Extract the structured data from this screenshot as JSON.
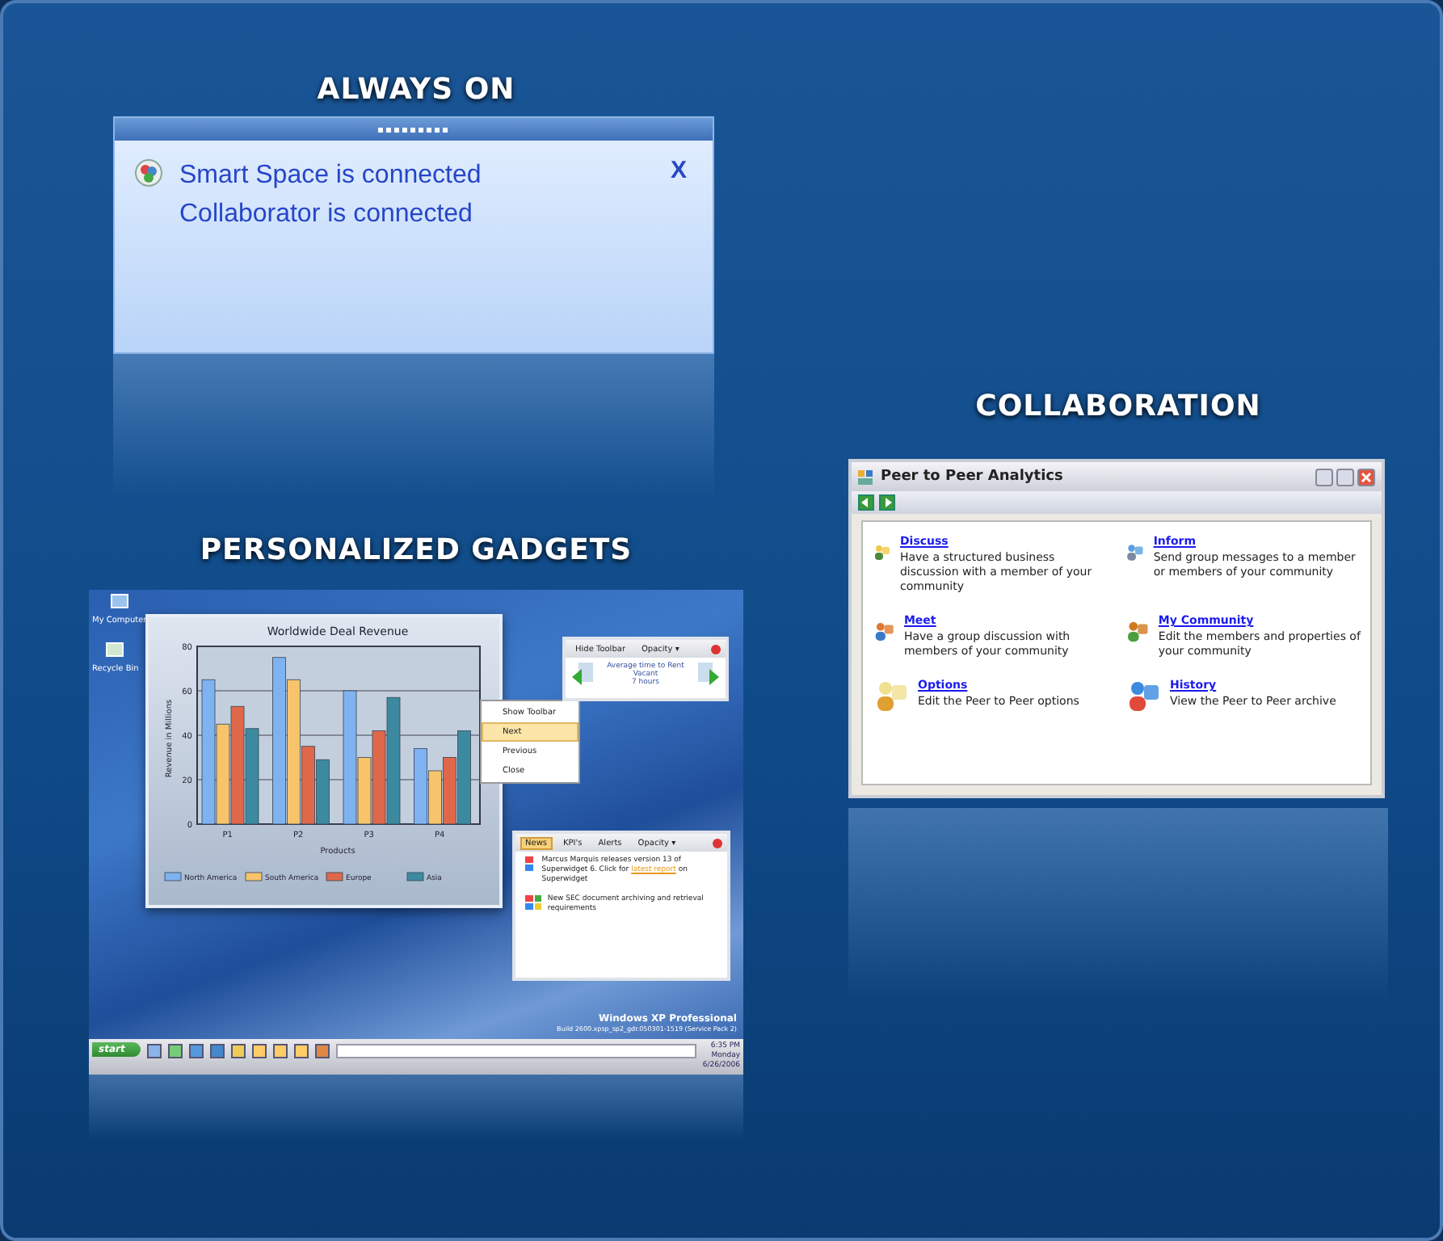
{
  "sections": [
    {
      "heading": "ALWAYS ON"
    },
    {
      "heading": "PERSONALIZED GADGETS"
    },
    {
      "heading": "COLLABORATION"
    }
  ],
  "notification": {
    "lines": [
      "Smart Space is connected",
      "Collaborator is connected"
    ],
    "close": "X"
  },
  "desktop": {
    "icons": [
      {
        "label": "My Computer"
      },
      {
        "label": "Recycle Bin"
      }
    ],
    "chart_window": {
      "chart_data": {
        "type": "bar",
        "title": "Worldwide Deal Revenue",
        "xlabel": "Products",
        "ylabel": "Revenue in Millions",
        "categories": [
          "P1",
          "P2",
          "P3",
          "P4"
        ],
        "yticks": [
          0,
          20,
          40,
          60,
          80
        ],
        "ylim": [
          0,
          80
        ],
        "grid": true,
        "legend": "bottom",
        "series": [
          {
            "name": "North America",
            "color": "#7fb2f0",
            "values": [
              65,
              75,
              60,
              34
            ]
          },
          {
            "name": "South America",
            "color": "#f7c46c",
            "values": [
              45,
              65,
              30,
              24
            ]
          },
          {
            "name": "Europe",
            "color": "#e0684a",
            "values": [
              53,
              35,
              42,
              30
            ]
          },
          {
            "name": "Asia",
            "color": "#3d8aa0",
            "values": [
              43,
              29,
              57,
              42
            ]
          }
        ]
      }
    },
    "context_menu": [
      {
        "label": "Show Toolbar",
        "selected": false
      },
      {
        "label": "Next",
        "selected": true
      },
      {
        "label": "Previous",
        "selected": false
      },
      {
        "label": "Close",
        "selected": false
      }
    ],
    "toolbar_gadget": {
      "buttons": [
        "Hide Toolbar",
        "Opacity ▾"
      ],
      "lines": [
        "Average time to Rent",
        "Vacant",
        "7 hours"
      ]
    },
    "news_gadget": {
      "tabs": [
        {
          "label": "News",
          "selected": true
        },
        {
          "label": "KPI's",
          "selected": false
        },
        {
          "label": "Alerts",
          "selected": false
        }
      ],
      "opacity": "Opacity ▾",
      "items": [
        {
          "text": "Marcus Marquis releases version 13 of Superwidget 6. Click for",
          "link": "latest report",
          "after": "on Superwidget"
        },
        {
          "text": "New SEC document archiving and retrieval requirements"
        }
      ]
    },
    "watermark": {
      "title": "Windows XP Professional",
      "build": "Build 2600.xpsp_sp2_gdr.050301-1519 (Service Pack 2)"
    },
    "taskbar": {
      "start": "start",
      "clock": [
        "6:35 PM",
        "Monday",
        "6/26/2006"
      ]
    }
  },
  "peer_window": {
    "title": "Peer to Peer Analytics",
    "items": [
      {
        "link": "Discuss",
        "text": "Have a structured business discussion with a member of your community"
      },
      {
        "link": "Inform",
        "text": "Send group messages to a member or members of your community"
      },
      {
        "link": "Meet",
        "text": "Have a group discussion with members of your community"
      },
      {
        "link": "My Community",
        "text": "Edit the members and properties of your community"
      },
      {
        "link": "Options",
        "text": "Edit the Peer to Peer options"
      },
      {
        "link": "History",
        "text": "View the Peer to Peer archive"
      }
    ]
  }
}
